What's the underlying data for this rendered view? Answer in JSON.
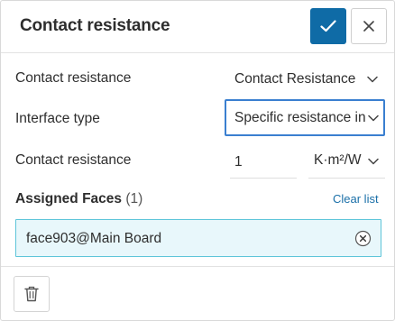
{
  "header": {
    "title": "Contact resistance",
    "confirm_icon": "checkmark-icon",
    "close_icon": "close-icon",
    "accent_color": "#0f6ba6"
  },
  "fields": {
    "contact_resistance_type": {
      "label": "Contact resistance",
      "value": "Contact Resistance"
    },
    "interface_type": {
      "label": "Interface type",
      "value": "Specific resistance in"
    },
    "resistance_value": {
      "label": "Contact resistance",
      "value": "1",
      "unit": "K·m²/W"
    }
  },
  "assigned_faces": {
    "label": "Assigned Faces",
    "count": "(1)",
    "clear_label": "Clear list",
    "items": [
      {
        "name": "face903@Main Board"
      }
    ],
    "highlight_color": "#e8f7fb",
    "border_color": "#5ec5d9"
  },
  "footer": {
    "delete_icon": "trash-icon"
  },
  "focus_color": "#3a7fd0"
}
